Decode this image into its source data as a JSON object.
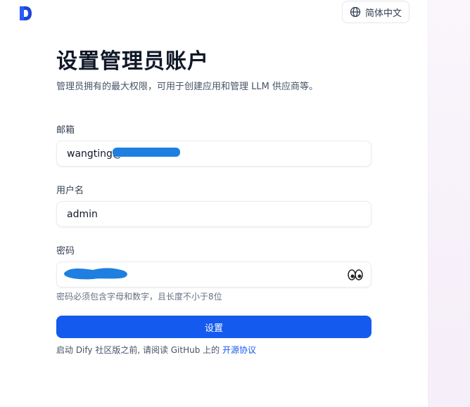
{
  "header": {
    "logo_icon": "dify-logo-icon",
    "language_button": {
      "icon": "globe-icon",
      "label": "简体中文"
    }
  },
  "main": {
    "title": "设置管理员账户",
    "subtitle": "管理员拥有的最大权限，可用于创建应用和管理 LLM 供应商等。"
  },
  "form": {
    "email": {
      "label": "邮箱",
      "value": "wangting@"
    },
    "username": {
      "label": "用户名",
      "value": "admin"
    },
    "password": {
      "label": "密码",
      "toggle_icon": "eyes-icon",
      "hint": "密码必须包含字母和数字，且长度不小于8位"
    },
    "submit_label": "设置"
  },
  "footer": {
    "text": "启动 Dify 社区版之前, 请阅读 GitHub 上的 ",
    "link_text": "开源协议"
  },
  "colors": {
    "primary": "#155aef",
    "redaction": "#1e7fe0",
    "title": "#101828"
  }
}
